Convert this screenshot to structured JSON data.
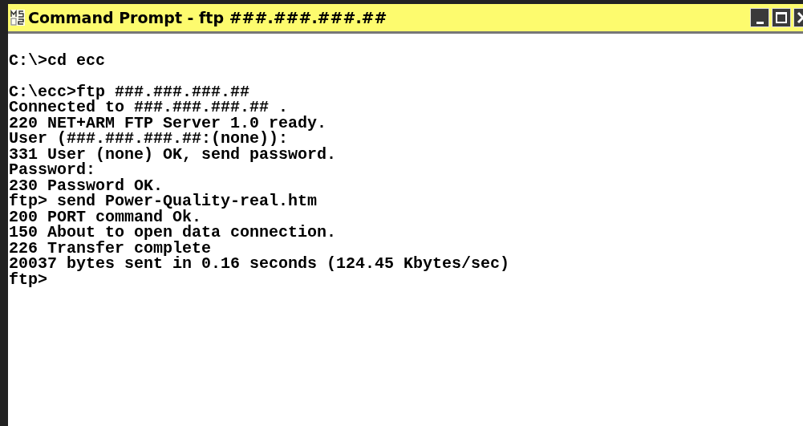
{
  "window": {
    "title": "Command Prompt - ftp ###.###.###.##",
    "controls": [
      {
        "kind": "minimize"
      },
      {
        "kind": "maximize"
      },
      {
        "kind": "close"
      }
    ]
  },
  "console": {
    "blocks": [
      [
        "C:\\>cd ecc"
      ],
      [
        "C:\\ecc>ftp ###.###.###.##",
        "Connected to ###.###.###.## .",
        "220 NET+ARM FTP Server 1.0 ready.",
        "User (###.###.###.##:(none)):",
        "331 User (none) OK, send password.",
        "Password:",
        "230 Password OK.",
        "ftp> send Power-Quality-real.htm",
        "200 PORT command Ok.",
        "150 About to open data connection.",
        "226 Transfer complete",
        "20037 bytes sent in 0.16 seconds (124.45 Kbytes/sec)",
        "ftp>"
      ]
    ]
  }
}
